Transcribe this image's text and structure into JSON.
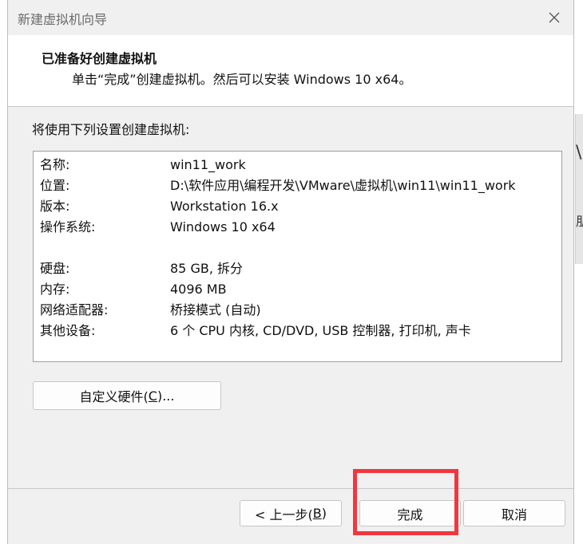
{
  "window": {
    "title": "新建虚拟机向导"
  },
  "header": {
    "title": "已准备好创建虚拟机",
    "subtitle": "单击“完成”创建虚拟机。然后可以安装 Windows 10 x64。"
  },
  "intro": "将使用下列设置创建虚拟机:",
  "summary": {
    "rows": [
      {
        "key": "名称:",
        "value": "win11_work"
      },
      {
        "key": "位置:",
        "value": "D:\\软件应用\\编程开发\\VMware\\虚拟机\\win11\\win11_work"
      },
      {
        "key": "版本:",
        "value": "Workstation 16.x"
      },
      {
        "key": "操作系统:",
        "value": "Windows 10 x64"
      },
      {
        "key": "硬盘:",
        "value": "85 GB, 拆分"
      },
      {
        "key": "内存:",
        "value": "4096 MB"
      },
      {
        "key": "网络适配器:",
        "value": "桥接模式 (自动)"
      },
      {
        "key": "其他设备:",
        "value": "6 个 CPU 内核, CD/DVD, USB 控制器, 打印机, 声卡"
      }
    ]
  },
  "buttons": {
    "customize_prefix": "自定义硬件(",
    "customize_key": "C",
    "customize_suffix": ")...",
    "back_prefix": "< 上一步(",
    "back_key": "B",
    "back_suffix": ")",
    "finish": "完成",
    "cancel": "取消"
  },
  "background_window": {
    "glyph_top": "\\",
    "glyph_bottom": "朋"
  },
  "colors": {
    "highlight": "#f1373e",
    "dialog_bg": "#f0f0f0"
  }
}
